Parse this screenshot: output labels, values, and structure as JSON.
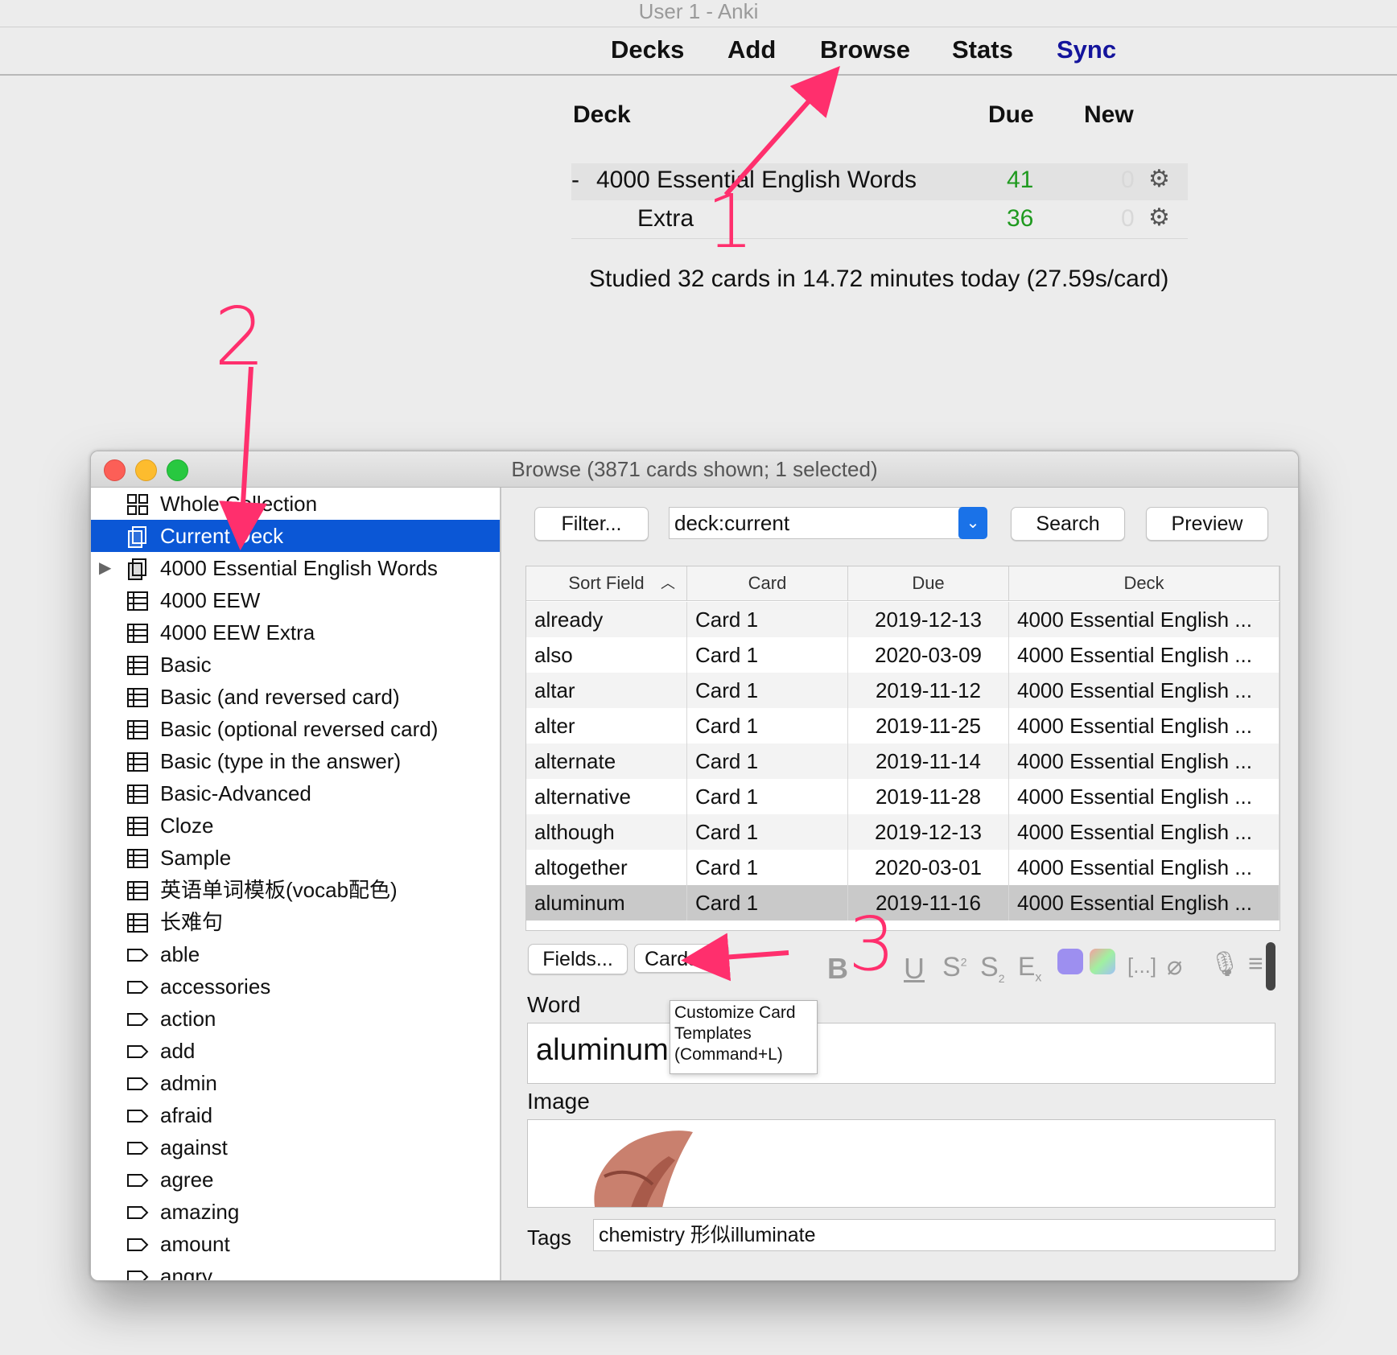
{
  "window_title": "User 1 - Anki",
  "toolbar": {
    "decks": "Decks",
    "add": "Add",
    "browse": "Browse",
    "stats": "Stats",
    "sync": "Sync"
  },
  "deck_list": {
    "headers": {
      "deck": "Deck",
      "due": "Due",
      "new": "New"
    },
    "rows": [
      {
        "prefix": "-",
        "name": "4000 Essential English Words",
        "due": "41",
        "new": "0"
      },
      {
        "prefix": "",
        "name": "Extra",
        "due": "36",
        "new": "0"
      }
    ],
    "studied": "Studied 32 cards in 14.72 minutes today (27.59s/card)"
  },
  "annotations": {
    "one": "1",
    "two": "2",
    "three": "3"
  },
  "browse": {
    "title": "Browse (3871 cards shown; 1 selected)",
    "sidebar": [
      {
        "icon": "collection-icon",
        "label": "Whole Collection"
      },
      {
        "icon": "deck-icon",
        "label": "Current Deck",
        "selected": true
      },
      {
        "icon": "deck-icon",
        "label": "4000 Essential English Words",
        "expandable": true
      },
      {
        "icon": "note-type-icon",
        "label": "4000 EEW"
      },
      {
        "icon": "note-type-icon",
        "label": "4000 EEW Extra"
      },
      {
        "icon": "note-type-icon",
        "label": "Basic"
      },
      {
        "icon": "note-type-icon",
        "label": "Basic (and reversed card)"
      },
      {
        "icon": "note-type-icon",
        "label": "Basic (optional reversed card)"
      },
      {
        "icon": "note-type-icon",
        "label": "Basic (type in the answer)"
      },
      {
        "icon": "note-type-icon",
        "label": "Basic-Advanced"
      },
      {
        "icon": "note-type-icon",
        "label": "Cloze"
      },
      {
        "icon": "note-type-icon",
        "label": "Sample"
      },
      {
        "icon": "note-type-icon",
        "label": "英语单词模板(vocab配色)"
      },
      {
        "icon": "note-type-icon",
        "label": "长难句"
      },
      {
        "icon": "tag-icon",
        "label": "able"
      },
      {
        "icon": "tag-icon",
        "label": "accessories"
      },
      {
        "icon": "tag-icon",
        "label": "action"
      },
      {
        "icon": "tag-icon",
        "label": "add"
      },
      {
        "icon": "tag-icon",
        "label": "admin"
      },
      {
        "icon": "tag-icon",
        "label": "afraid"
      },
      {
        "icon": "tag-icon",
        "label": "against"
      },
      {
        "icon": "tag-icon",
        "label": "agree"
      },
      {
        "icon": "tag-icon",
        "label": "amazing"
      },
      {
        "icon": "tag-icon",
        "label": "amount"
      },
      {
        "icon": "tag-icon",
        "label": "angry"
      }
    ],
    "filter_label": "Filter...",
    "search_value": "deck:current",
    "search_label": "Search",
    "preview_label": "Preview",
    "columns": [
      "Sort Field",
      "Card",
      "Due",
      "Deck"
    ],
    "rows": [
      [
        "already",
        "Card 1",
        "2019-12-13",
        "4000 Essential English ..."
      ],
      [
        "also",
        "Card 1",
        "2020-03-09",
        "4000 Essential English ..."
      ],
      [
        "altar",
        "Card 1",
        "2019-11-12",
        "4000 Essential English ..."
      ],
      [
        "alter",
        "Card 1",
        "2019-11-25",
        "4000 Essential English ..."
      ],
      [
        "alternate",
        "Card 1",
        "2019-11-14",
        "4000 Essential English ..."
      ],
      [
        "alternative",
        "Card 1",
        "2019-11-28",
        "4000 Essential English ..."
      ],
      [
        "although",
        "Card 1",
        "2019-12-13",
        "4000 Essential English ..."
      ],
      [
        "altogether",
        "Card 1",
        "2020-03-01",
        "4000 Essential English ..."
      ],
      [
        "aluminum",
        "Card 1",
        "2019-11-16",
        "4000 Essential English ..."
      ]
    ],
    "selected_row": 8,
    "editor": {
      "fields_label": "Fields...",
      "cards_label": "Cards",
      "tooltip": [
        "Customize Card",
        "Templates",
        "(Command+L)"
      ],
      "word_label": "Word",
      "word_value": "aluminum",
      "image_label": "Image",
      "tags_label": "Tags",
      "tags_value": "chemistry 形似illuminate"
    }
  },
  "colors": {
    "accent": "#0b57d6",
    "due_green": "#1f9a1f",
    "sync_blue": "#14149c",
    "annotation_pink": "#ff2f6d"
  }
}
